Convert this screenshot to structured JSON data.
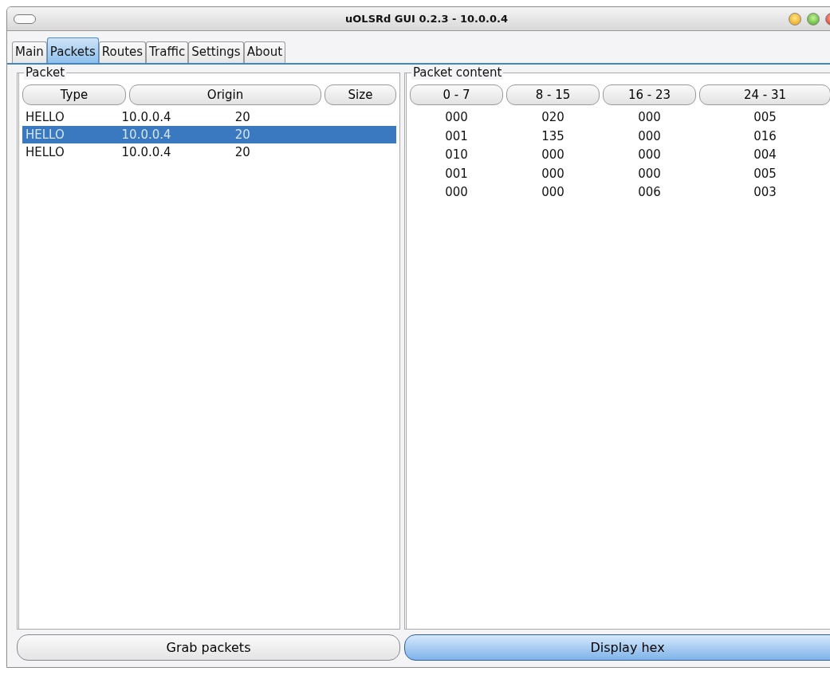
{
  "window": {
    "title": "uOLSRd GUI 0.2.3 - 10.0.0.4"
  },
  "tabs": [
    {
      "label": "Main",
      "selected": false
    },
    {
      "label": "Packets",
      "selected": true
    },
    {
      "label": "Routes",
      "selected": false
    },
    {
      "label": "Traffic",
      "selected": false
    },
    {
      "label": "Settings",
      "selected": false
    },
    {
      "label": "About",
      "selected": false
    }
  ],
  "packet_panel": {
    "title": "Packet",
    "columns": [
      "Type",
      "Origin",
      "Size"
    ],
    "rows": [
      {
        "cells": [
          "HELLO",
          "10.0.0.4",
          "20"
        ],
        "selected": false
      },
      {
        "cells": [
          "HELLO",
          "10.0.0.4",
          "20"
        ],
        "selected": true
      },
      {
        "cells": [
          "HELLO",
          "10.0.0.4",
          "20"
        ],
        "selected": false
      }
    ]
  },
  "content_panel": {
    "title": "Packet content",
    "columns": [
      "0 - 7",
      "8 - 15",
      "16 - 23",
      "24 - 31"
    ],
    "rows": [
      [
        "000",
        "020",
        "000",
        "005"
      ],
      [
        "001",
        "135",
        "000",
        "016"
      ],
      [
        "010",
        "000",
        "000",
        "004"
      ],
      [
        "001",
        "000",
        "000",
        "005"
      ],
      [
        "000",
        "000",
        "006",
        "003"
      ]
    ]
  },
  "buttons": [
    {
      "label": "Grab packets",
      "on": false
    },
    {
      "label": "Display hex",
      "on": true
    }
  ]
}
